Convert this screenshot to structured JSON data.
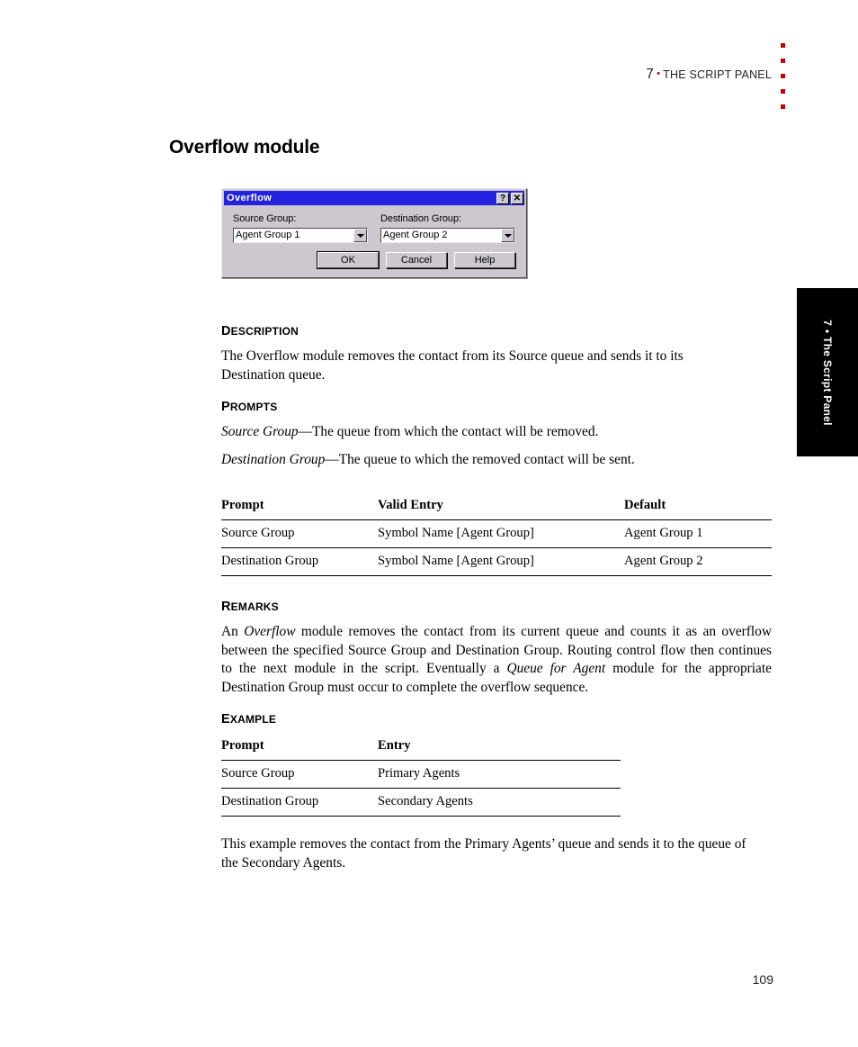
{
  "header": {
    "chapter_number": "7",
    "bullet": "•",
    "chapter_title": "The Script Panel",
    "dot_count": 5,
    "dot_color": "#cc0000"
  },
  "thumb_tab": {
    "label": "7 • The Script Panel",
    "background": "#000000",
    "text_color": "#ffffff"
  },
  "page": {
    "title": "Overflow module",
    "folio": "109"
  },
  "dialog": {
    "title": "Overflow",
    "titlebar_color": "#2222e0",
    "face_color": "#cdc7cf",
    "help_button": "?",
    "close_button": "✕",
    "fields": [
      {
        "label": "Source Group:",
        "value": "Agent Group 1"
      },
      {
        "label": "Destination Group:",
        "value": "Agent Group 2"
      }
    ],
    "buttons": [
      {
        "label": "OK",
        "default": true
      },
      {
        "label": "Cancel",
        "default": false
      },
      {
        "label": "Help",
        "default": false
      }
    ]
  },
  "sections": {
    "description": {
      "heading_cap": "D",
      "heading_rest": "ESCRIPTION",
      "paragraph": "The Overflow module removes the contact from its Source queue and sends it to its Destination queue."
    },
    "prompts": {
      "heading_cap": "P",
      "heading_rest": "ROMPTS",
      "items": [
        {
          "term": "Source Group",
          "dash": "—",
          "definition": "The queue from which the contact will be removed."
        },
        {
          "term": "Destination Group",
          "dash": "—",
          "definition": "The queue to which the removed contact will be sent."
        }
      ]
    },
    "remarks": {
      "heading_cap": "R",
      "heading_rest": "EMARKS",
      "paragraph_part1": "An ",
      "italic1": "Overflow",
      "paragraph_part2": " module removes the contact from its current queue and counts it as an overflow between the specified Source Group and Destination Group. Routing control flow then continues to the next module in the script. Eventually a ",
      "italic2": "Queue for Agent",
      "paragraph_part3": " module for the appropriate Destination Group must occur to complete the overflow sequence."
    },
    "example": {
      "heading_cap": "E",
      "heading_rest": "XAMPLE",
      "closing_paragraph": "This example removes the contact from the Primary Agents’ queue and sends it to the queue of the Secondary Agents."
    }
  },
  "table_prompts": {
    "headers": [
      "Prompt",
      "Valid Entry",
      "Default"
    ],
    "rows": [
      [
        "Source Group",
        "Symbol Name [Agent Group]",
        "Agent Group 1"
      ],
      [
        "Destination Group",
        "Symbol Name [Agent Group]",
        "Agent Group 2"
      ]
    ]
  },
  "table_example": {
    "headers": [
      "Prompt",
      "Entry"
    ],
    "rows": [
      [
        "Source Group",
        "Primary Agents"
      ],
      [
        "Destination Group",
        "Secondary Agents"
      ]
    ]
  }
}
